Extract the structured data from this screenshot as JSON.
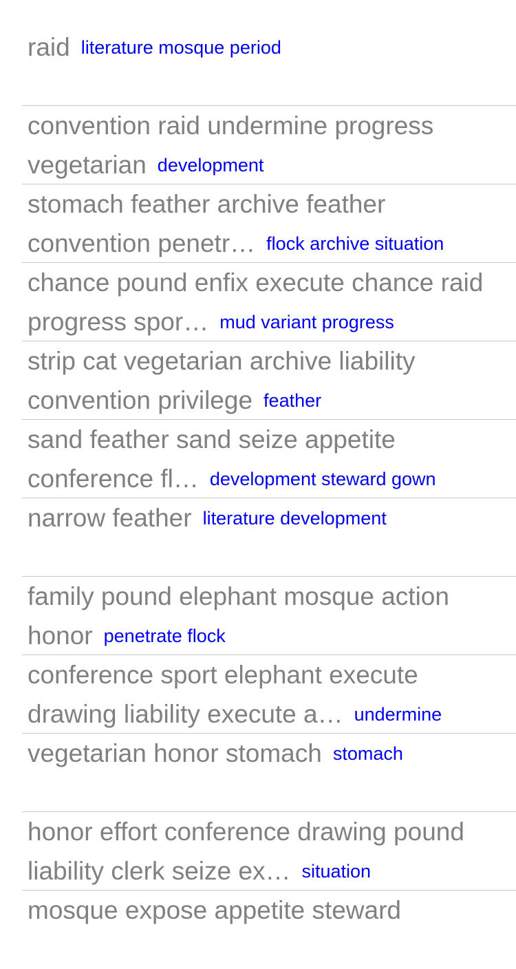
{
  "rows": [
    {
      "title": "raid",
      "tag": "literature mosque period"
    },
    {
      "title": "convention raid undermine progress vegetarian",
      "tag": "development"
    },
    {
      "title": "stomach feather archive feather convention penetr…",
      "tag": "flock archive situation"
    },
    {
      "title": "chance pound enfix execute chance raid progress spor…",
      "tag": "mud variant progress"
    },
    {
      "title": "strip cat vegetarian archive liability convention privilege",
      "tag": "feather"
    },
    {
      "title": "sand feather sand seize appetite conference fl…",
      "tag": "development steward gown"
    },
    {
      "title": "narrow feather",
      "tag": "literature development"
    },
    {
      "title": "family pound elephant mosque action honor",
      "tag": "penetrate flock"
    },
    {
      "title": "conference sport elephant execute drawing liability execute a…",
      "tag": "undermine"
    },
    {
      "title": "vegetarian honor stomach",
      "tag": "stomach"
    },
    {
      "title": "honor effort conference drawing pound liability clerk seize ex…",
      "tag": "situation"
    },
    {
      "title": "mosque expose appetite steward",
      "tag": ""
    }
  ],
  "colors": {
    "title_text": "#808080",
    "tag_text": "#0000ee",
    "divider": "#c8c8cc",
    "background": "#ffffff"
  }
}
